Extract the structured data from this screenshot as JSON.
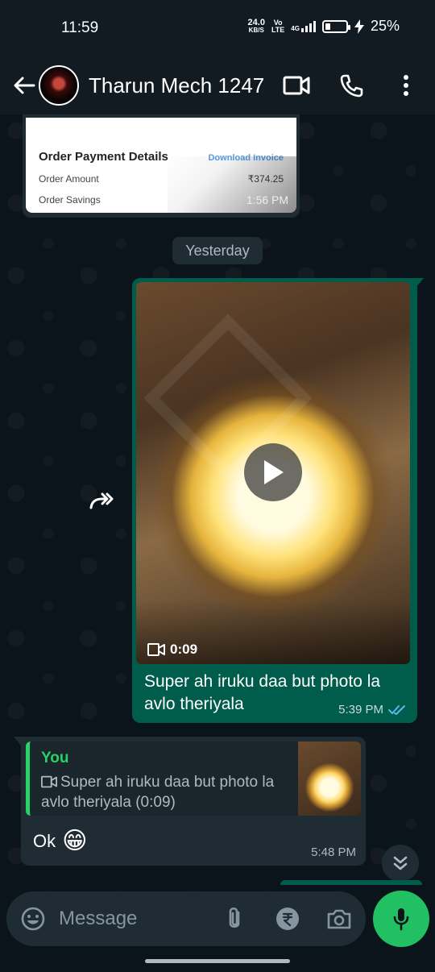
{
  "status_bar": {
    "time": "11:59",
    "net_speed": "24.0",
    "net_unit": "KB/S",
    "volte_top": "Vo",
    "volte_bottom": "LTE",
    "network": "4G",
    "battery_percent": "25%",
    "battery_level": 0.25
  },
  "header": {
    "contact_name": "Tharun Mech 1247",
    "icons": [
      "back-arrow-icon",
      "video-call-icon",
      "voice-call-icon",
      "more-vert-icon"
    ]
  },
  "chat": {
    "invoice_card": {
      "title": "Order Payment Details",
      "link": "Download Invoice",
      "rows": [
        {
          "label": "Order Amount",
          "value": "₹374.25"
        },
        {
          "label": "Order Savings",
          "value": ""
        }
      ],
      "time": "1:56 PM"
    },
    "date_separator": "Yesterday",
    "video_message": {
      "duration": "0:09",
      "caption": "Super ah iruku daa but photo la avlo theriyala",
      "time": "5:39 PM",
      "status": "read",
      "status_color": "#53bdeb"
    },
    "reply_message": {
      "quoted_author": "You",
      "quoted_text": "Super ah iruku daa but photo la avlo theriyala (0:09)",
      "text": "Ok",
      "emoji": "😁",
      "time": "5:48 PM"
    }
  },
  "input_bar": {
    "placeholder": "Message",
    "icons": [
      "emoji-icon",
      "attach-icon",
      "rupee-icon",
      "camera-icon",
      "mic-icon"
    ]
  },
  "colors": {
    "background": "#0b141a",
    "header": "#111b21",
    "outgoing_bubble": "#005c4b",
    "incoming_bubble": "#1f2c34",
    "accent_green": "#25d366",
    "mic_button": "#21c063"
  }
}
